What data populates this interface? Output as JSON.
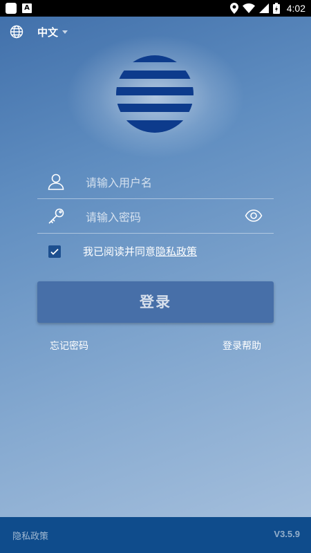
{
  "status_bar": {
    "time": "4:02"
  },
  "language": {
    "label": "中文",
    "icon": "globe-icon"
  },
  "logo": {
    "icon": "striped-globe-logo",
    "color": "#0d3b8c"
  },
  "form": {
    "username_placeholder": "请输入用户名",
    "password_placeholder": "请输入密码",
    "agree_text": "我已阅读并同意",
    "agree_link": "隐私政策",
    "agree_checked": true,
    "login_label": "登录"
  },
  "links": {
    "forgot_password": "忘记密码",
    "login_help": "登录帮助"
  },
  "footer": {
    "privacy": "隐私政策",
    "version": "V3.5.9"
  },
  "colors": {
    "accent": "#476fa8",
    "footer_bg": "#0f4c8c",
    "checkbox": "#1d4f8f"
  }
}
